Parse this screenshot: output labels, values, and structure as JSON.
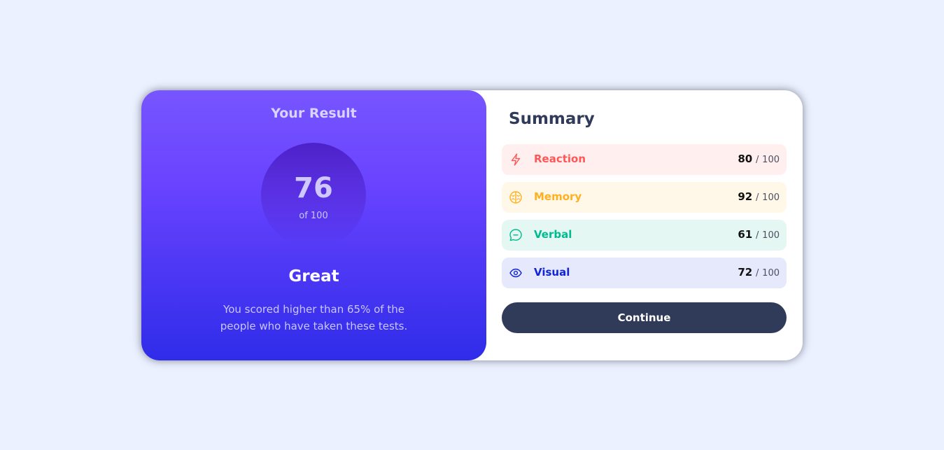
{
  "result": {
    "title": "Your Result",
    "score": "76",
    "score_of": "of 100",
    "verdict": "Great",
    "description": "You scored higher than 65% of the people who have taken these tests."
  },
  "summary": {
    "title": "Summary",
    "separator": "/",
    "items": [
      {
        "label": "Reaction",
        "score": "80",
        "max": "100",
        "icon": "lightning-icon",
        "color": "#ff5757",
        "bg": "#fff0ef"
      },
      {
        "label": "Memory",
        "score": "92",
        "max": "100",
        "icon": "brain-icon",
        "color": "#ffb020",
        "bg": "#fff8e9"
      },
      {
        "label": "Verbal",
        "score": "61",
        "max": "100",
        "icon": "chat-bubble-icon",
        "color": "#00bb8f",
        "bg": "#e5f7f3"
      },
      {
        "label": "Visual",
        "score": "72",
        "max": "100",
        "icon": "eye-icon",
        "color": "#1125d4",
        "bg": "#e6e9fb"
      }
    ],
    "continue_label": "Continue"
  }
}
